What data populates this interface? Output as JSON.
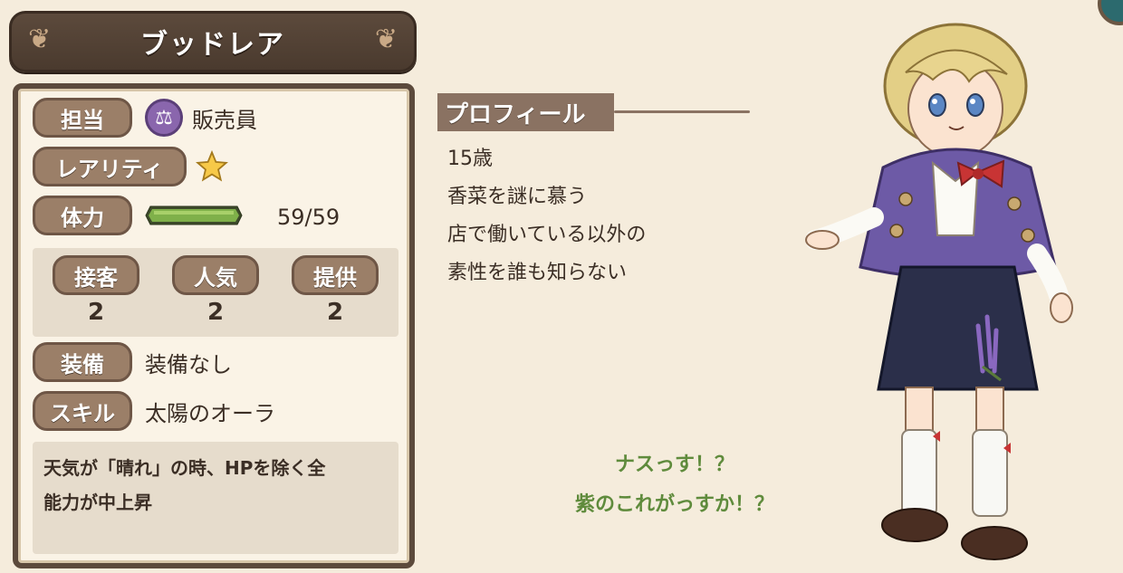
{
  "character": {
    "name": "ブッドレア"
  },
  "stats": {
    "role_label": "担当",
    "role_value": "販売員",
    "role_icon": "scales-icon",
    "rarity_label": "レアリティ",
    "rarity_stars": 1,
    "hp_label": "体力",
    "hp_value": "59/59",
    "hp_fill": 1.0,
    "sub_stats": [
      {
        "label": "接客",
        "value": "2"
      },
      {
        "label": "人気",
        "value": "2"
      },
      {
        "label": "提供",
        "value": "2"
      }
    ],
    "equip_label": "装備",
    "equip_value": "装備なし",
    "skill_label": "スキル",
    "skill_value": "太陽のオーラ",
    "skill_desc_1": "天気が「晴れ」の時、HPを除く全",
    "skill_desc_2": "能力が中上昇"
  },
  "profile": {
    "header": "プロフィール",
    "lines": [
      "15歳",
      "香菜を謎に慕う",
      "店で働いている以外の",
      "素性を誰も知らない"
    ]
  },
  "quote": {
    "line1": "ナスっす！？",
    "line2": "紫のこれがっすか！？"
  },
  "colors": {
    "accent_brown": "#5c4a3c",
    "pill_brown": "#9b7f68",
    "hp_green": "#7fb04a",
    "quote_green": "#5f8b3c",
    "role_purple": "#8a66ad"
  }
}
